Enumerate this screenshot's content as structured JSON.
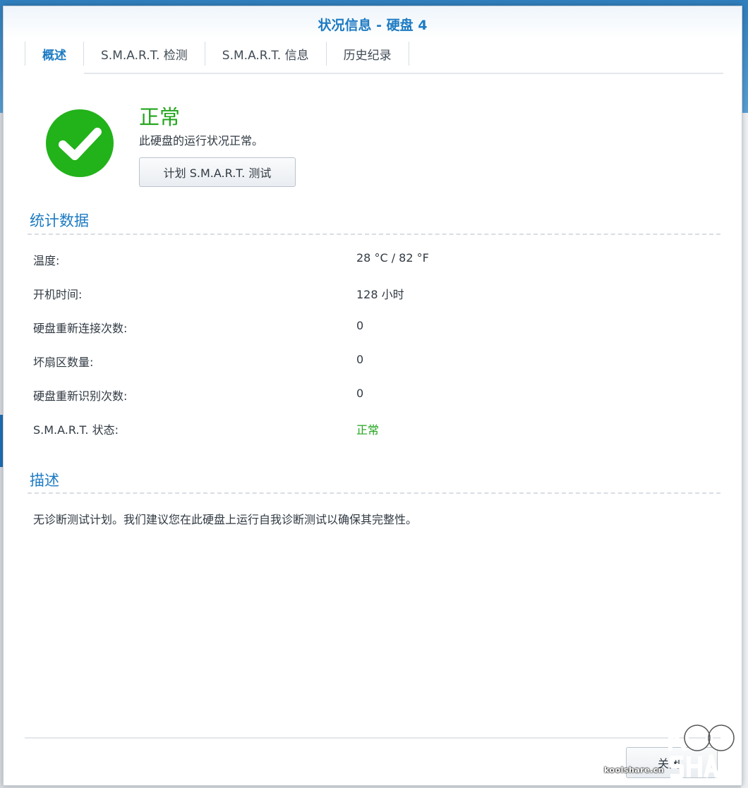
{
  "dialog": {
    "title": "状况信息 - 硬盘 4"
  },
  "tabs": [
    {
      "label": "概述",
      "active": true
    },
    {
      "label": "S.M.A.R.T. 检测"
    },
    {
      "label": "S.M.A.R.T. 信息"
    },
    {
      "label": "历史纪录"
    }
  ],
  "status": {
    "icon": "check-circle-icon",
    "title": "正常",
    "description": "此硬盘的运行状况正常。",
    "schedule_button": "计划 S.M.A.R.T. 测试",
    "color": "#22a51c"
  },
  "stats": {
    "title": "统计数据",
    "rows": [
      {
        "label": "温度:",
        "value": "28 °C / 82 °F"
      },
      {
        "label": "开机时间:",
        "value": "128 小时"
      },
      {
        "label": "硬盘重新连接次数:",
        "value": "0"
      },
      {
        "label": "坏扇区数量:",
        "value": "0"
      },
      {
        "label": "硬盘重新识别次数:",
        "value": "0"
      },
      {
        "label": "S.M.A.R.T. 状态:",
        "value": "正常"
      }
    ]
  },
  "description": {
    "title": "描述",
    "text": "无诊断测试计划。我们建议您在此硬盘上运行自我诊断测试以确保其完整性。"
  },
  "footer": {
    "close_label": "关闭"
  },
  "watermark": {
    "url": "koolshare.cn",
    "logo_text": "KOOL SHARE"
  },
  "colors": {
    "accent": "#1d7bc3",
    "ok": "#22a51c"
  }
}
